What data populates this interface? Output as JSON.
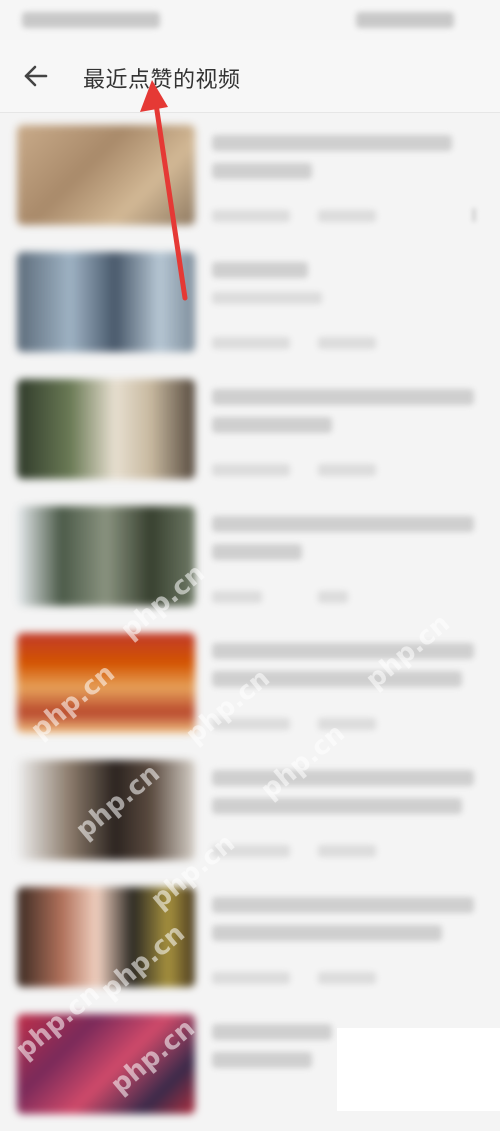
{
  "header": {
    "title": "最近点赞的视频",
    "back_icon": "back-arrow-icon"
  },
  "status_bar": {
    "blurred": true
  },
  "video_list": {
    "item_count": 8,
    "content_blurred": true
  },
  "annotation": {
    "arrow_color": "#e53935"
  },
  "watermark": {
    "text": "php.cn"
  },
  "colors": {
    "background": "#f4f4f4",
    "header_bg": "#f7f7f7"
  }
}
